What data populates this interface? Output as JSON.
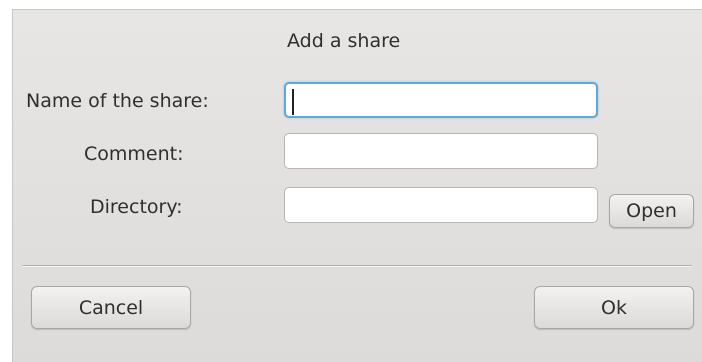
{
  "dialog": {
    "title": "Add a share"
  },
  "form": {
    "name_label": "Name of the share:",
    "name_value": "",
    "comment_label": "Comment:",
    "comment_value": "",
    "directory_label": "Directory:",
    "directory_value": "",
    "open_button": "Open"
  },
  "footer": {
    "cancel_label": "Cancel",
    "ok_label": "Ok"
  },
  "colors": {
    "panel_bg": "#e3e1df",
    "focus_border": "#5fa8d8"
  }
}
